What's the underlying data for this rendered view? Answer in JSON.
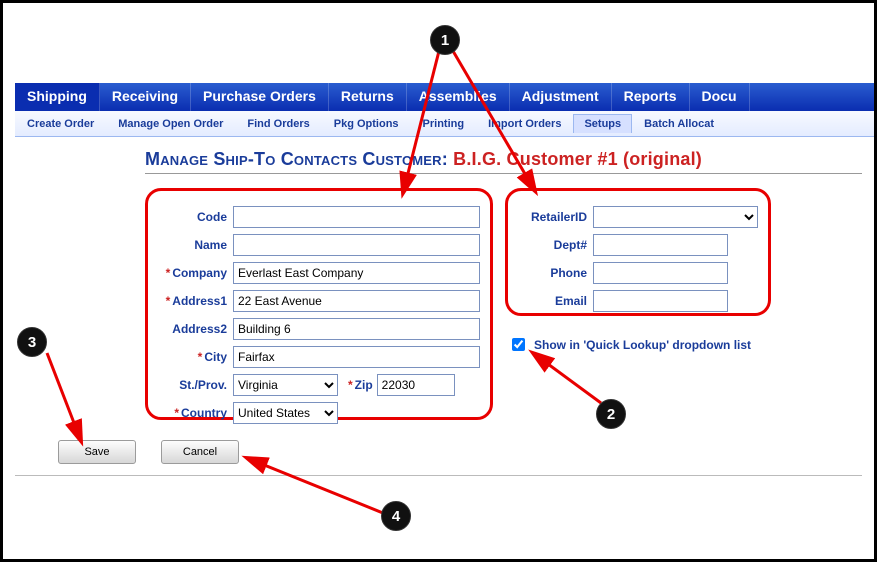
{
  "nav": [
    "Shipping",
    "Receiving",
    "Purchase Orders",
    "Returns",
    "Assemblies",
    "Adjustment",
    "Reports",
    "Docu"
  ],
  "nav_active": 0,
  "subnav": [
    "Create Order",
    "Manage Open Order",
    "Find Orders",
    "Pkg Options",
    "Printing",
    "Import Orders",
    "Setups",
    "Batch Allocat"
  ],
  "subnav_active": 6,
  "title": {
    "heading": "Manage Ship-To Contacts ",
    "cust_label": "Customer: ",
    "cust_value": "B.I.G. Customer #1 (original)"
  },
  "left": {
    "code_label": "Code",
    "code": "",
    "name_label": "Name",
    "name": "",
    "company_label": "Company",
    "company": "Everlast East Company",
    "address1_label": "Address1",
    "address1": "22 East Avenue",
    "address2_label": "Address2",
    "address2": "Building 6",
    "city_label": "City",
    "city": "Fairfax",
    "stprov_label": "St./Prov.",
    "stprov": "Virginia",
    "zip_label": "Zip",
    "zip": "22030",
    "country_label": "Country",
    "country": "United States"
  },
  "right": {
    "retailerid_label": "RetailerID",
    "retailerid": "",
    "dept_label": "Dept#",
    "dept": "",
    "phone_label": "Phone",
    "phone": "",
    "email_label": "Email",
    "email": ""
  },
  "quick_lookup": {
    "label": "Show in 'Quick Lookup' dropdown list",
    "checked": true
  },
  "buttons": {
    "save": "Save",
    "cancel": "Cancel"
  },
  "badges": {
    "b1": "1",
    "b2": "2",
    "b3": "3",
    "b4": "4"
  }
}
